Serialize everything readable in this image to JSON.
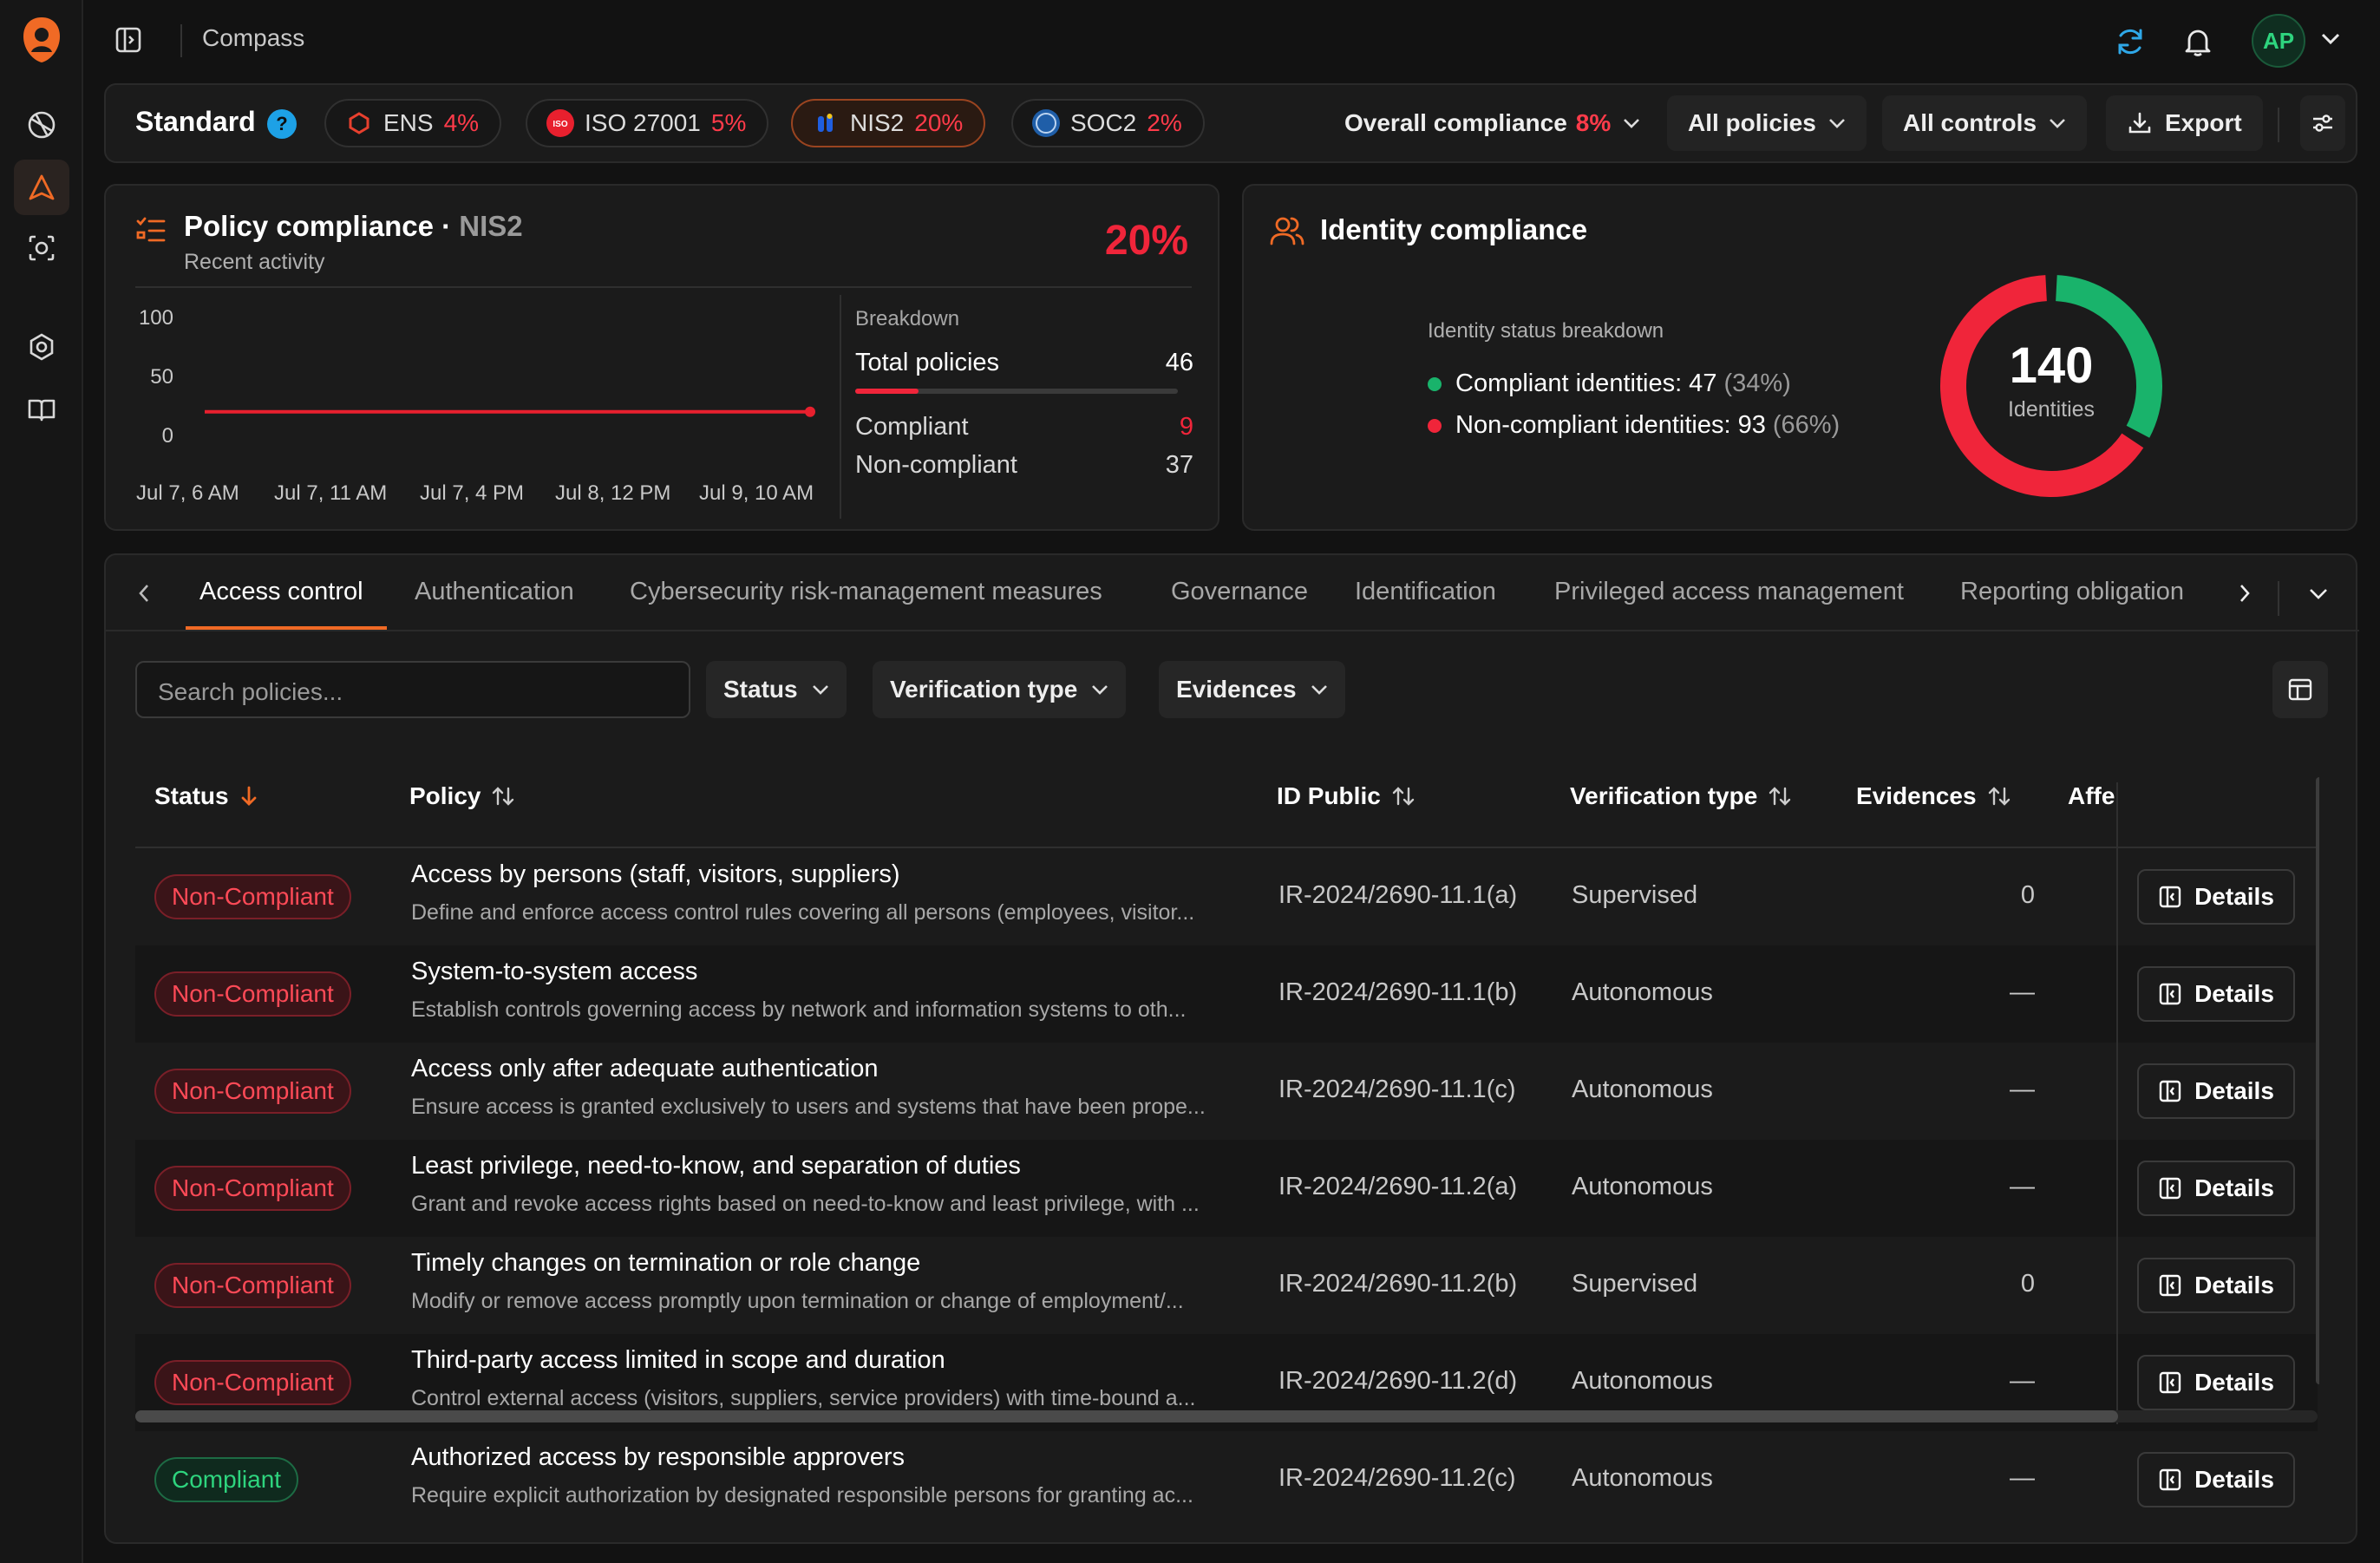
{
  "app": {
    "title": "Compass",
    "avatar": "AP"
  },
  "standards": {
    "label": "Standard",
    "help": "?",
    "items": [
      {
        "name": "ENS",
        "pct": "4%"
      },
      {
        "name": "ISO 27001",
        "pct": "5%"
      },
      {
        "name": "NIS2",
        "pct": "20%"
      },
      {
        "name": "SOC2",
        "pct": "2%"
      }
    ],
    "overall_label": "Overall compliance",
    "overall_pct": "8%",
    "policies_dd": "All policies",
    "controls_dd": "All controls",
    "export": "Export"
  },
  "policy_card": {
    "title": "Policy compliance",
    "dot": "·",
    "standard": "NIS2",
    "subtitle": "Recent activity",
    "pct": "20%",
    "breakdown_label": "Breakdown",
    "total_label": "Total policies",
    "total_value": "46",
    "compliant_label": "Compliant",
    "compliant_value": "9",
    "noncompliant_label": "Non-compliant",
    "noncompliant_value": "37",
    "compliant_fraction": 0.1957
  },
  "chart_data": {
    "type": "line",
    "title": "",
    "x": [
      "Jul 7, 6 AM",
      "Jul 7, 11 AM",
      "Jul 7, 4 PM",
      "Jul 8, 12 PM",
      "Jul 9, 10 AM"
    ],
    "series": [
      {
        "values": [
          20,
          20,
          20,
          20,
          20
        ]
      }
    ],
    "yticks": [
      "100",
      "50",
      "0"
    ],
    "ylim": [
      0,
      100
    ],
    "color": "#e8202e"
  },
  "identity_card": {
    "title": "Identity compliance",
    "breakdown_label": "Identity status breakdown",
    "compliant_text": "Compliant identities: 47",
    "compliant_pct": "(34%)",
    "noncompliant_text": "Non-compliant identities: 93",
    "noncompliant_pct": "(66%)",
    "total": "140",
    "total_label": "Identities",
    "compliant_count": 47,
    "noncompliant_count": 93,
    "compliant_color": "#19b36b",
    "noncompliant_color": "#f0253a"
  },
  "tabs": [
    "Access control",
    "Authentication",
    "Cybersecurity risk-management measures",
    "Governance",
    "Identification",
    "Privileged access management",
    "Reporting obligation"
  ],
  "filters": {
    "search_placeholder": "Search policies...",
    "status": "Status",
    "verification": "Verification type",
    "evidences": "Evidences"
  },
  "table": {
    "headers": {
      "status": "Status",
      "policy": "Policy",
      "id": "ID Public",
      "verification": "Verification type",
      "evidences": "Evidences",
      "affected": "Affe"
    },
    "details_label": "Details",
    "rows": [
      {
        "status": "Non-Compliant",
        "title": "Access by persons (staff, visitors, suppliers)",
        "desc": "Define and enforce access control rules covering all persons (employees, visitor...",
        "id": "IR-2024/2690-11.1(a)",
        "verification": "Supervised",
        "evidences": "0"
      },
      {
        "status": "Non-Compliant",
        "title": "System-to-system access",
        "desc": "Establish controls governing access by network and information systems to oth...",
        "id": "IR-2024/2690-11.1(b)",
        "verification": "Autonomous",
        "evidences": "—"
      },
      {
        "status": "Non-Compliant",
        "title": "Access only after adequate authentication",
        "desc": "Ensure access is granted exclusively to users and systems that have been prope...",
        "id": "IR-2024/2690-11.1(c)",
        "verification": "Autonomous",
        "evidences": "—"
      },
      {
        "status": "Non-Compliant",
        "title": "Least privilege, need-to-know, and separation of duties",
        "desc": "Grant and revoke access rights based on need-to-know and least privilege, with ...",
        "id": "IR-2024/2690-11.2(a)",
        "verification": "Autonomous",
        "evidences": "—"
      },
      {
        "status": "Non-Compliant",
        "title": "Timely changes on termination or role change",
        "desc": "Modify or remove access promptly upon termination or change of employment/...",
        "id": "IR-2024/2690-11.2(b)",
        "verification": "Supervised",
        "evidences": "0"
      },
      {
        "status": "Non-Compliant",
        "title": "Third-party access limited in scope and duration",
        "desc": "Control external access (visitors, suppliers, service providers) with time-bound a...",
        "id": "IR-2024/2690-11.2(d)",
        "verification": "Autonomous",
        "evidences": "—"
      },
      {
        "status": "Compliant",
        "title": "Authorized access by responsible approvers",
        "desc": "Require explicit authorization by designated responsible persons for granting ac...",
        "id": "IR-2024/2690-11.2(c)",
        "verification": "Autonomous",
        "evidences": "—"
      }
    ]
  }
}
